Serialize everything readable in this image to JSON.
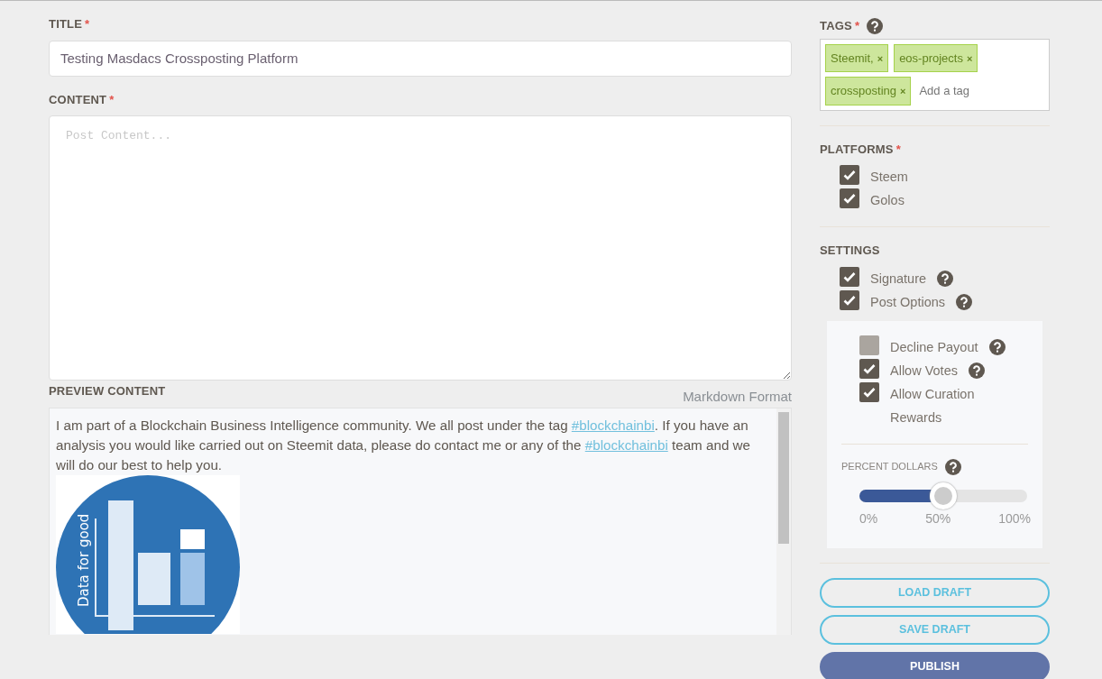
{
  "title_field": {
    "label": "TITLE",
    "required_mark": "*",
    "value": "Testing Masdacs Crossposting Platform"
  },
  "content_field": {
    "label": "CONTENT",
    "required_mark": "*",
    "placeholder": "Post Content...",
    "hint": "Markdown Format"
  },
  "preview": {
    "label": "PREVIEW CONTENT",
    "paragraph": [
      {
        "kind": "text",
        "text": "I am part of a Blockchain Business Intelligence community. We all post under the tag "
      },
      {
        "kind": "link",
        "text": "#blockchainbi"
      },
      {
        "kind": "text",
        "text": ". If you have an analysis you would like carried out on Steemit data, please do contact me or any of the "
      },
      {
        "kind": "link",
        "text": "#blockchainbi"
      },
      {
        "kind": "text",
        "text": " team and we will do our best to help you."
      }
    ],
    "logo": {
      "side_text": "Data for good"
    }
  },
  "tags": {
    "label": "TAGS",
    "required_mark": "*",
    "help": true,
    "items": [
      {
        "text": "Steemit,",
        "remove": "×"
      },
      {
        "text": "eos-projects",
        "remove": "×"
      },
      {
        "text": "crossposting",
        "remove": "×"
      }
    ],
    "placeholder": "Add a tag"
  },
  "platforms": {
    "label": "PLATFORMS",
    "required_mark": "*",
    "items": [
      {
        "label": "Steem",
        "checked": true,
        "help": false
      },
      {
        "label": "Golos",
        "checked": true,
        "help": false
      }
    ]
  },
  "settings": {
    "label": "SETTINGS",
    "items": [
      {
        "label": "Signature",
        "checked": true,
        "help": true
      },
      {
        "label": "Post Options",
        "checked": true,
        "help": true
      }
    ]
  },
  "post_options": {
    "items": [
      {
        "label": "Decline Payout",
        "checked": false,
        "help": true
      },
      {
        "label": "Allow Votes",
        "checked": true,
        "help": true
      },
      {
        "label": "Allow Curation Rewards",
        "checked": true,
        "help": false
      }
    ],
    "percent_dollars": {
      "label": "PERCENT DOLLARS",
      "help": true,
      "level": 0.5,
      "ticks": [
        "0%",
        "50%",
        "100%"
      ]
    }
  },
  "buttons": [
    {
      "label": "LOAD DRAFT",
      "kind": "outline"
    },
    {
      "label": "SAVE DRAFT",
      "kind": "outline"
    },
    {
      "label": "PUBLISH",
      "kind": "solid"
    }
  ]
}
